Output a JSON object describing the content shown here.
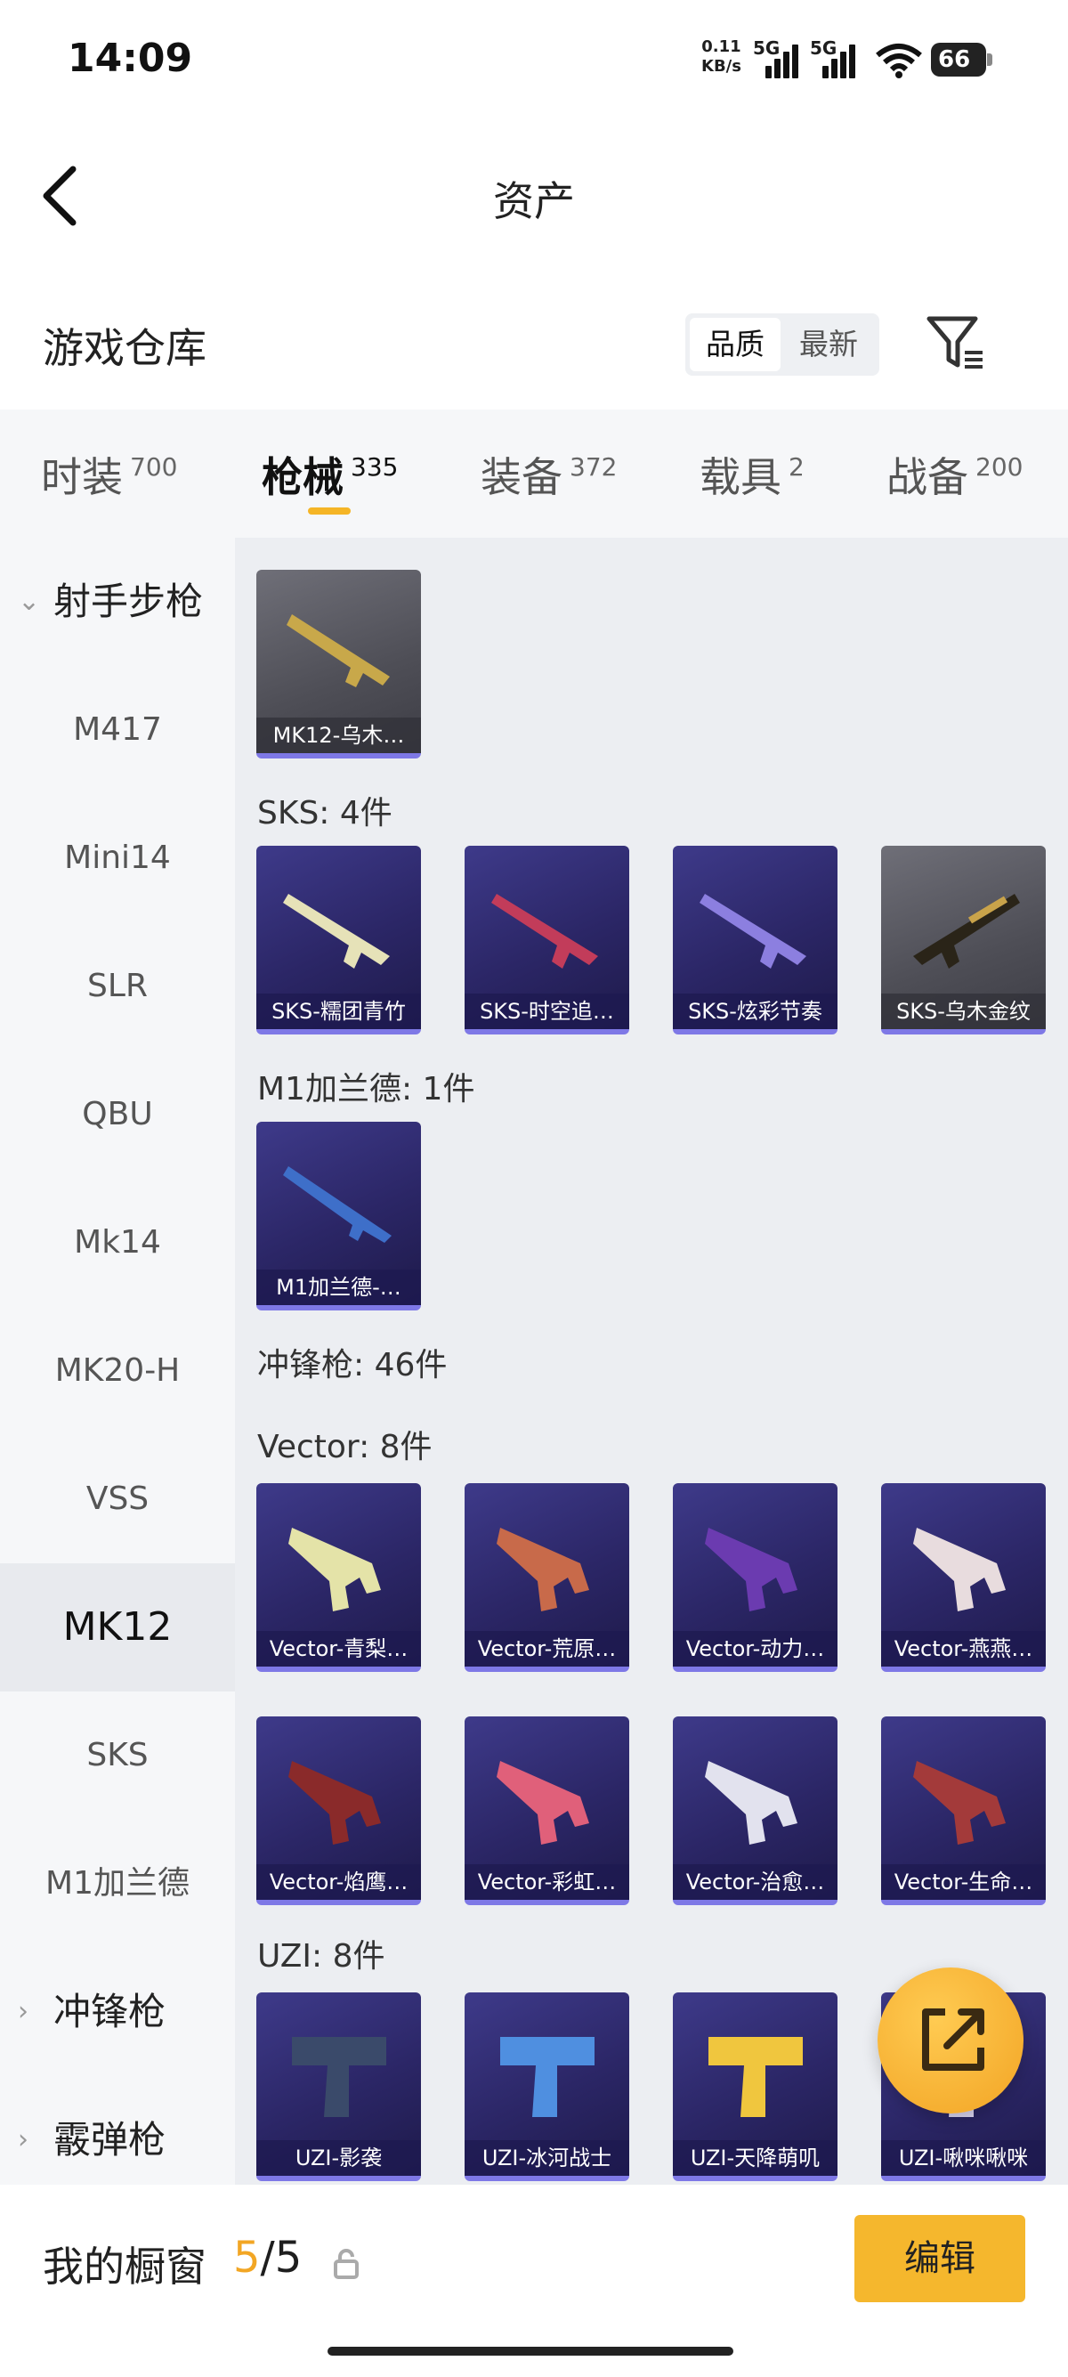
{
  "status": {
    "time": "14:09",
    "net_speed_value": "0.11",
    "net_speed_unit": "KB/s",
    "sim1": "5G",
    "sim2": "5G",
    "battery": "66"
  },
  "header": {
    "title": "资产"
  },
  "warehouse": {
    "title": "游戏仓库",
    "sort_quality": "品质",
    "sort_newest": "最新"
  },
  "tabs": [
    {
      "label": "时装",
      "count": "700"
    },
    {
      "label": "枪械",
      "count": "335"
    },
    {
      "label": "装备",
      "count": "372"
    },
    {
      "label": "载具",
      "count": "2"
    },
    {
      "label": "战备",
      "count": "200"
    }
  ],
  "sidebar": {
    "category_open": "射手步枪",
    "items": [
      "M417",
      "Mini14",
      "SLR",
      "QBU",
      "Mk14",
      "MK20-H",
      "VSS",
      "MK12",
      "SKS",
      "M1加兰德"
    ],
    "active_item": "MK12",
    "category_smg": "冲锋枪",
    "category_shotgun": "霰弹枪"
  },
  "content": {
    "mk12_cards": [
      "MK12-乌木…"
    ],
    "sks_label": "SKS: 4件",
    "sks_cards": [
      "SKS-糯团青竹",
      "SKS-时空追…",
      "SKS-炫彩节奏",
      "SKS-乌木金纹"
    ],
    "m1_label": "M1加兰德: 1件",
    "m1_cards": [
      "M1加兰德-…"
    ],
    "smg_label": "冲锋枪: 46件",
    "vector_label": "Vector: 8件",
    "vector_cards": [
      "Vector-青梨…",
      "Vector-荒原…",
      "Vector-动力…",
      "Vector-燕燕…",
      "Vector-焰鹰…",
      "Vector-彩虹…",
      "Vector-治愈…",
      "Vector-生命…"
    ],
    "uzi_label": "UZI: 8件",
    "uzi_cards": [
      "UZI-影袭",
      "UZI-冰河战士",
      "UZI-天降萌叽",
      "UZI-啾咪啾咪"
    ]
  },
  "bottom": {
    "title": "我的橱窗",
    "count_current": "5",
    "count_total": "/5",
    "edit_label": "编辑"
  },
  "colors": {
    "accent": "#f5b526",
    "card_bg": "#2b2666",
    "card_border": "#7e78e6"
  }
}
